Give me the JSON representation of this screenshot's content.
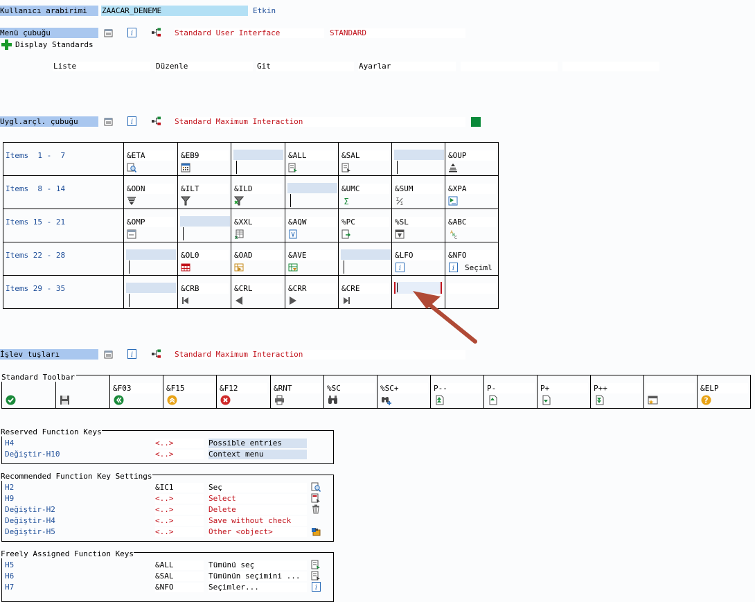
{
  "header": {
    "user_interface_label": "Kullanıcı arabirimi",
    "user_interface_value": "ZAACAR_DENEME",
    "status": "Etkin"
  },
  "menu_bar": {
    "label": "Menü çubuğu",
    "name": "Standard User Interface",
    "code": "STANDARD",
    "display_standards": "Display Standards",
    "menus": [
      "Liste",
      "Düzenle",
      "Git",
      "Ayarlar",
      "",
      ""
    ]
  },
  "app_toolbar": {
    "label": "Uygl.arçl. çubuğu",
    "name": "Standard Maximum Interaction",
    "rows": [
      {
        "label": "Items  1 -  7",
        "items": [
          {
            "code": "&ETA",
            "icon": "detail-icon"
          },
          {
            "code": "&EB9",
            "icon": "calculator-icon"
          },
          {
            "code": "",
            "icon": ""
          },
          {
            "code": "&ALL",
            "icon": "select-all-icon"
          },
          {
            "code": "&SAL",
            "icon": "deselect-all-icon"
          },
          {
            "code": "",
            "icon": ""
          },
          {
            "code": "&OUP",
            "icon": "sort-ascending-icon"
          }
        ]
      },
      {
        "label": "Items  8 - 14",
        "items": [
          {
            "code": "&ODN",
            "icon": "sort-descending-icon"
          },
          {
            "code": "&ILT",
            "icon": "filter-icon"
          },
          {
            "code": "&ILD",
            "icon": "delete-filter-icon"
          },
          {
            "code": "",
            "icon": ""
          },
          {
            "code": "&UMC",
            "icon": "sum-icon"
          },
          {
            "code": "&SUM",
            "icon": "subtotal-icon"
          },
          {
            "code": "&XPA",
            "icon": "expand-icon"
          }
        ]
      },
      {
        "label": "Items 15 - 21",
        "items": [
          {
            "code": "&OMP",
            "icon": "collapse-icon"
          },
          {
            "code": "",
            "icon": ""
          },
          {
            "code": "&XXL",
            "icon": "excel-icon"
          },
          {
            "code": "&AQW",
            "icon": "word-icon"
          },
          {
            "code": "%PC",
            "icon": "local-file-icon"
          },
          {
            "code": "%SL",
            "icon": "mail-icon"
          },
          {
            "code": "&ABC",
            "icon": "abc-analysis-icon"
          }
        ]
      },
      {
        "label": "Items 22 - 28",
        "items": [
          {
            "code": "",
            "icon": ""
          },
          {
            "code": "&OL0",
            "icon": "layout-icon"
          },
          {
            "code": "&OAD",
            "icon": "choose-layout-icon"
          },
          {
            "code": "&AVE",
            "icon": "save-layout-icon"
          },
          {
            "code": "",
            "icon": ""
          },
          {
            "code": "&LFO",
            "icon": "info-icon"
          },
          {
            "code": "&NFO",
            "icon": "info-icon",
            "extra": "Seçiml"
          }
        ]
      },
      {
        "label": "Items 29 - 35",
        "items": [
          {
            "code": "",
            "icon": ""
          },
          {
            "code": "&CRB",
            "icon": "first-column-icon"
          },
          {
            "code": "&CRL",
            "icon": "previous-column-icon"
          },
          {
            "code": "&CRR",
            "icon": "next-column-icon"
          },
          {
            "code": "&CRE",
            "icon": "last-column-icon"
          },
          {
            "code": "",
            "icon": "",
            "selected": true
          },
          {
            "code": "",
            "icon": ""
          }
        ]
      }
    ]
  },
  "function_keys": {
    "label": "İşlev tuşları",
    "name": "Standard Maximum Interaction"
  },
  "standard_toolbar": {
    "label": "Standard Toolbar",
    "items": [
      {
        "code": "",
        "icon": "enter-icon"
      },
      {
        "code": "",
        "icon": "save-icon"
      },
      {
        "code": "&F03",
        "icon": "back-icon"
      },
      {
        "code": "&F15",
        "icon": "exit-icon"
      },
      {
        "code": "&F12",
        "icon": "cancel-icon"
      },
      {
        "code": "&RNT",
        "icon": "print-icon"
      },
      {
        "code": "%SC",
        "icon": "find-icon"
      },
      {
        "code": "%SC+",
        "icon": "find-next-icon"
      },
      {
        "code": "P--",
        "icon": "first-page-icon"
      },
      {
        "code": "P-",
        "icon": "previous-page-icon"
      },
      {
        "code": "P+",
        "icon": "next-page-icon"
      },
      {
        "code": "P++",
        "icon": "last-page-icon"
      },
      {
        "code": "",
        "icon": "create-session-icon"
      },
      {
        "code": "&ELP",
        "icon": "help-icon"
      }
    ]
  },
  "reserved_keys": {
    "title": "Reserved Function Keys",
    "rows": [
      {
        "key": "H4",
        "code": "<..>",
        "text": "Possible entries"
      },
      {
        "key": "Değiştir-H10",
        "code": "<..>",
        "text": "Context menu"
      }
    ]
  },
  "recommended_keys": {
    "title": "Recommended Function Key Settings",
    "rows": [
      {
        "key": "H2",
        "code": "&IC1",
        "text": "Seç",
        "icon": "detail-icon"
      },
      {
        "key": "H9",
        "code": "<..>",
        "text": "Select",
        "icon": "select-icon"
      },
      {
        "key": "Değiştir-H2",
        "code": "<..>",
        "text": "Delete",
        "icon": "trash-icon"
      },
      {
        "key": "Değiştir-H4",
        "code": "<..>",
        "text": "Save without check",
        "icon": ""
      },
      {
        "key": "Değiştir-H5",
        "code": "<..>",
        "text": "Other <object>",
        "icon": "other-object-icon"
      }
    ]
  },
  "freely_assigned_keys": {
    "title": "Freely Assigned Function Keys",
    "rows": [
      {
        "key": "H5",
        "code": "&ALL",
        "text": "Tümünü seç",
        "icon": "select-all-icon"
      },
      {
        "key": "H6",
        "code": "&SAL",
        "text": "Tümünün seçimini ...",
        "icon": "deselect-all-icon"
      },
      {
        "key": "H7",
        "code": "&NFO",
        "text": "Seçimler...",
        "icon": "info-icon"
      }
    ]
  },
  "colors": {
    "accent_red": "#c1121b",
    "key_blue": "#20509a",
    "label_bg": "#a9c7ef",
    "annotation_arrow": "#b04a36",
    "status_green": "#0a8a3a"
  }
}
